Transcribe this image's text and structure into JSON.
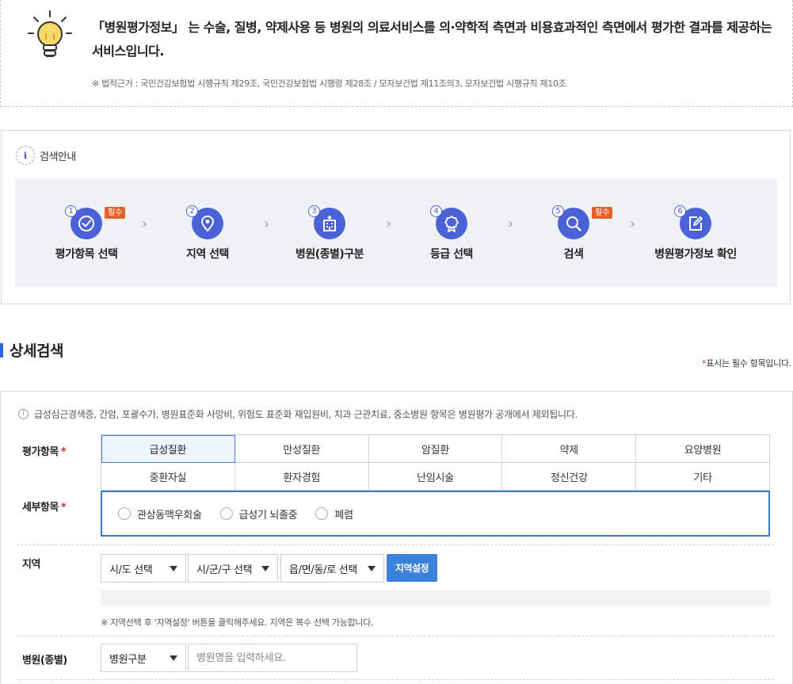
{
  "notice": {
    "text": "「병원평가정보」 는 수술, 질병, 약제사용 등 병원의 의료서비스를 의·약학적 측면과 비용효과적인 측면에서 평가한 결과를 제공하는 서비스입니다.",
    "basis": "※ 법적근거 : 국민건강보험법 시행규칙 제29조, 국민건강보험법 시행령 제28조 / 모자보건법 제11조의3, 모자보건법 시행규칙 제10조"
  },
  "guide": {
    "info_glyph": "i",
    "title": "검색안내",
    "required_badge": "필수",
    "steps": [
      {
        "num": "1",
        "label": "평가항목 선택",
        "icon": "check-circle-icon",
        "required": true
      },
      {
        "num": "2",
        "label": "지역 선택",
        "icon": "location-pin-icon",
        "required": false
      },
      {
        "num": "3",
        "label": "병원(종별)구분",
        "icon": "hospital-building-icon",
        "required": false
      },
      {
        "num": "4",
        "label": "등급 선택",
        "icon": "medal-icon",
        "required": false
      },
      {
        "num": "5",
        "label": "검색",
        "icon": "search-icon",
        "required": true
      },
      {
        "num": "6",
        "label": "병원평가정보 확인",
        "icon": "edit-icon",
        "required": false
      }
    ],
    "arrow_glyph": "›"
  },
  "detail_search": {
    "title": "상세검색",
    "required_note_star": "*",
    "required_note": "표시는 필수 항목입니다."
  },
  "form": {
    "info_icon": "i",
    "info": "급성심근경색증, 간암, 포괄수가, 병원표준화 사망비, 위험도 표준화 재입원비, 치과 근관치료, 중소병원 항목은 병원평가 공개에서 제외됩니다.",
    "required_star": "*",
    "eval_label": "평가항목",
    "categories": [
      "급성질환",
      "만성질환",
      "암질환",
      "약제",
      "요양병원",
      "중환자실",
      "환자경험",
      "난임시술",
      "정신건강",
      "기타"
    ],
    "active_category": "급성질환",
    "sub_label": "세부항목",
    "sub_items": [
      "관상동맥우회술",
      "급성기 뇌졸중",
      "폐렴"
    ],
    "region_label": "지역",
    "region_selects": [
      "시/도 선택",
      "시/군/구 선택",
      "읍/면/동/로 선택"
    ],
    "region_button": "지역설정",
    "region_note": "※ 지역선택 후 '지역설정' 버튼을 클릭해주세요. 지역은 복수 선택 가능합니다.",
    "hospital_label": "병원(종별)",
    "hospital_select": "병원구분",
    "hospital_placeholder": "병원명을 입력하세요."
  },
  "colors": {
    "accent": "#4a62d6",
    "required_badge": "#e4612a",
    "primary_button": "#3b82dc",
    "required_star": "#d2302a"
  }
}
